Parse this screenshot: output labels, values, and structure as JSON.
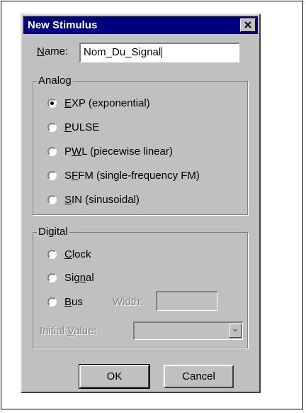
{
  "dialog": {
    "title": "New Stimulus",
    "name": {
      "label_key": "N",
      "label_rest": "ame:",
      "value": "Nom_Du_Signal"
    },
    "analog": {
      "legend": "Analog",
      "options": [
        {
          "pre": "",
          "key": "E",
          "post": "XP (exponential)",
          "selected": true
        },
        {
          "pre": "",
          "key": "P",
          "post": "ULSE",
          "selected": false
        },
        {
          "pre": "P",
          "key": "W",
          "post": "L (piecewise linear)",
          "selected": false
        },
        {
          "pre": "S",
          "key": "F",
          "post": "FM (single-frequency FM)",
          "selected": false
        },
        {
          "pre": "",
          "key": "S",
          "post": "IN (sinusoidal)",
          "selected": false
        }
      ]
    },
    "digital": {
      "legend": "Digital",
      "options": [
        {
          "pre": "",
          "key": "C",
          "post": "lock",
          "selected": false
        },
        {
          "pre": "Sig",
          "key": "n",
          "post": "al",
          "selected": false
        },
        {
          "pre": "",
          "key": "B",
          "post": "us",
          "selected": false
        }
      ],
      "width_label": "Width:",
      "width_value": "",
      "initial_value": {
        "label_pre": "Initial ",
        "label_key": "V",
        "label_post": "alue:",
        "value": ""
      }
    },
    "buttons": {
      "ok": "OK",
      "cancel": "Cancel"
    },
    "icons": {
      "close": "close-x-icon",
      "dropdown": "chevron-down-icon"
    }
  }
}
